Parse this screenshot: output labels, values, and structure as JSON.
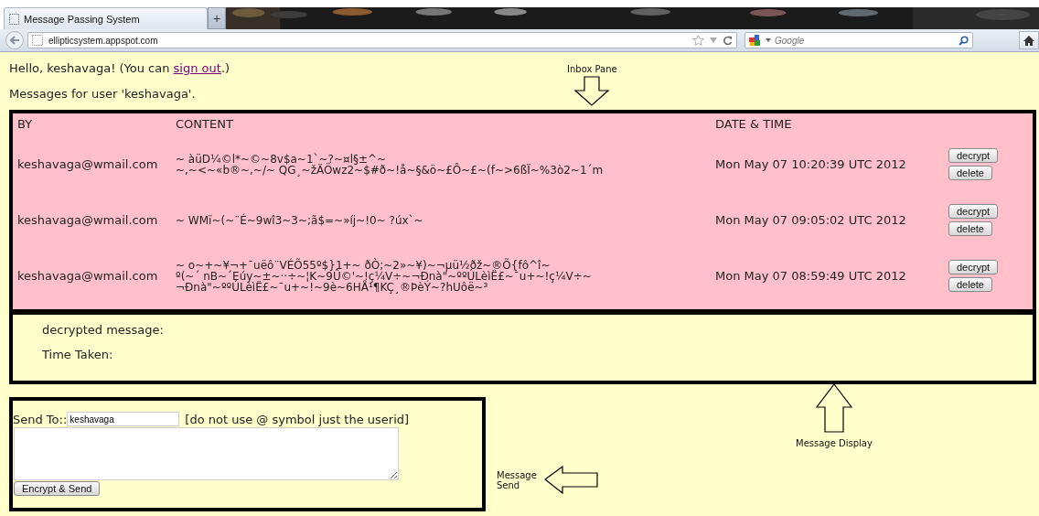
{
  "browser": {
    "tab_title": "Message Passing System",
    "new_tab": "+",
    "address": "ellipticsystem.appspot.com",
    "search_placeholder": "Google"
  },
  "greeting": {
    "before": "Hello, keshavaga! (You can ",
    "link": "sign out",
    "after": ".)"
  },
  "messages_heading": "Messages for user 'keshavaga'.",
  "inbox": {
    "columns": [
      "BY",
      "CONTENT",
      "DATE & TIME"
    ],
    "rows": [
      {
        "by": "keshavaga@wmail.com",
        "content": [
          "~ àüD¼©l*~©~8v$a~1`~?~¤l§±^~",
          "~,~<~«b®~,~/~ QG¸~žÄÖwz2~$#ð~!å~§&ö~£Ô~£~(f~>6ßÏ~%3ò2~1´m"
        ],
        "date": "Mon May 07 10:20:39 UTC 2012",
        "actions": [
          "decrypt",
          "delete"
        ]
      },
      {
        "by": "keshavaga@wmail.com",
        "content": [
          "~ WMï~(~¨É~9wî3~3~;ã$=~»íj~!0~ ?úx`~"
        ],
        "date": "Mon May 07 09:05:02 UTC 2012",
        "actions": [
          "decrypt",
          "delete"
        ]
      },
      {
        "by": "keshavaga@wmail.com",
        "content": [
          "~ o~+~¥¬+¯uëô¨VÉÕ55º$}1+~ ðÒ;~2»~¥)~¬µü½ðž~®Õ{fô^î~",
          "º(~´ nB~´Eúy~±~··÷~¦K~9Û©'~!ç¼V÷~¬Ðnà\"~ººÚLèìË£~¯u+~!ç¼V÷~",
          "¬Ðnà\"~ººÚLèìË£~¯u+~!~9è~6HÅ¹¶KÇ¸®ÞèÝ~?hUôë~³"
        ],
        "date": "Mon May 07 08:59:49 UTC 2012",
        "actions": [
          "decrypt",
          "delete"
        ]
      }
    ]
  },
  "display": {
    "fields": [
      "decrypted message:",
      "Time Taken:"
    ]
  },
  "send": {
    "label": "Send To::",
    "recipient": {
      "value": "keshavaga"
    },
    "hint": "[do not use @ symbol just the userid]",
    "button": "Encrypt & Send"
  },
  "annotations": [
    {
      "kind": "down",
      "lines": [
        "Inbox Pane"
      ]
    },
    {
      "kind": "up",
      "lines": [
        "Message Display"
      ]
    },
    {
      "kind": "left",
      "lines": [
        "Message",
        "Send"
      ]
    }
  ]
}
